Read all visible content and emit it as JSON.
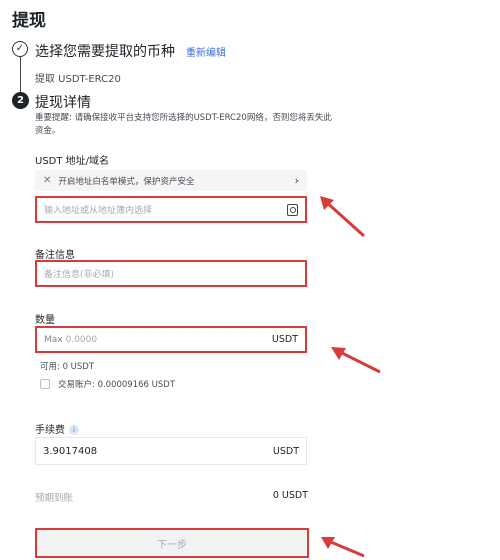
{
  "page": {
    "title": "提现"
  },
  "step1": {
    "title": "选择您需要提取的币种",
    "reedit": "重新编辑",
    "subtitle": "提取 USDT-ERC20"
  },
  "step2": {
    "number": "2",
    "title": "提现详情",
    "notice": "重要提醒: 请确保接收平台支持您所选择的USDT-ERC20网络，否则您将丢失此资金。"
  },
  "address": {
    "label": "USDT 地址/域名",
    "whitelist_text": "开启地址白名单模式，保护资产安全",
    "placeholder": "输入地址或从地址簿内选择"
  },
  "memo": {
    "label": "备注信息",
    "placeholder": "备注信息(非必填)"
  },
  "amount": {
    "label": "数量",
    "max_label": "Max",
    "placeholder": "0.0000",
    "unit": "USDT",
    "available": "可用: 0 USDT",
    "trading_account": "交易账户: 0.00009166 USDT"
  },
  "fee": {
    "label": "手续费",
    "value": "3.9017408",
    "unit": "USDT"
  },
  "arrival": {
    "label": "预期到账",
    "value": "0 USDT"
  },
  "next_button": "下一步",
  "colors": {
    "highlight": "#d93a3a",
    "link": "#3a6fd8"
  }
}
